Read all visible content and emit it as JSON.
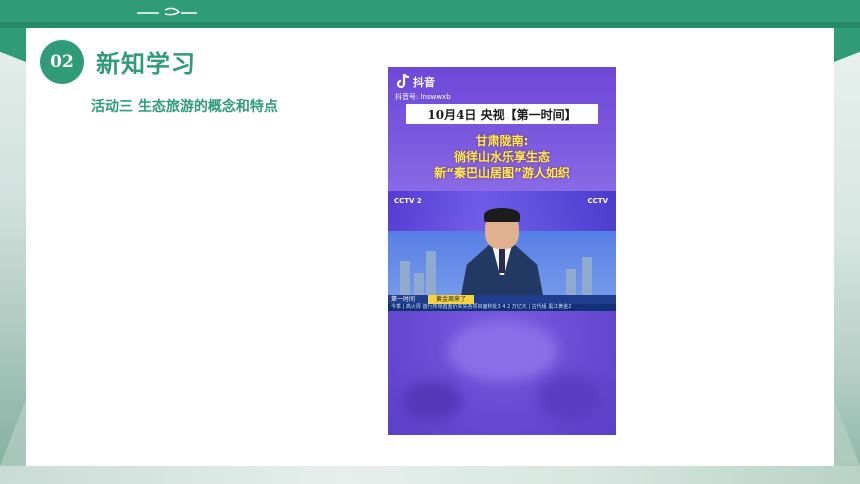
{
  "header": {
    "number": "02",
    "title": "新知学习",
    "activity": "活动三  生态旅游的概念和特点"
  },
  "video": {
    "app_name": "抖音",
    "account": "抖音号: lnswwxb",
    "date_banner": "10月4日 央视【第一时间】",
    "headline_lines": [
      "甘肃陇南:",
      "徜徉山水乐享生态",
      "新“秦巴山居图”游人如织"
    ],
    "cctv_left": "CCTV 2",
    "cctv_right": "CCTV",
    "ticker_program": "第一时间",
    "ticker_tag": "黄金周来了",
    "ticker_bottom": "今季 | 高火周  首行所领首金价实实各项目面积处3 4 2 万亿元      |  古代组  黑江黄金2"
  },
  "colors": {
    "accent": "#2f9c77",
    "video_purple": "#6d48d6",
    "headline_yellow": "#ffe96a"
  }
}
